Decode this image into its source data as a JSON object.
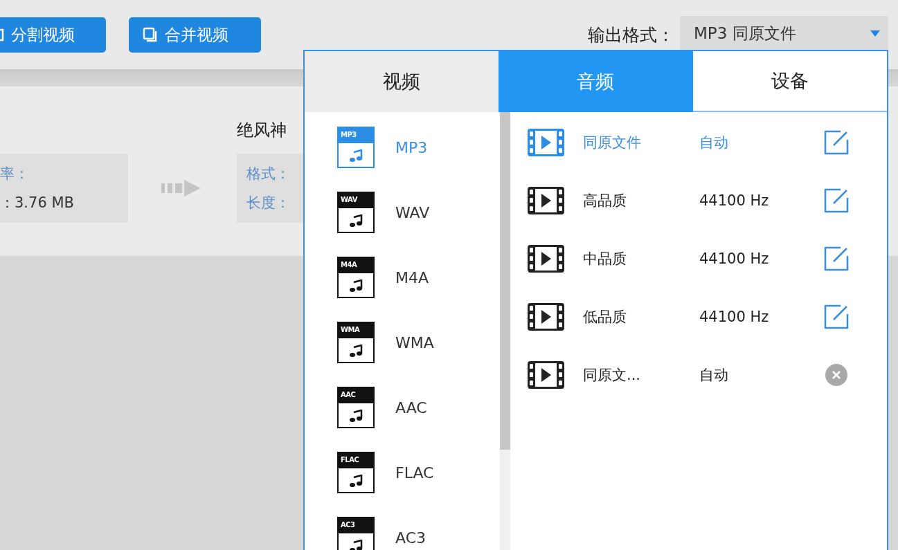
{
  "toolbar": {
    "buttons": [
      {
        "label": "分割视频",
        "kind": "split"
      },
      {
        "label": "合并视频",
        "kind": "merge"
      }
    ],
    "output_format": {
      "label": "输出格式：",
      "value": "MP3  同原文件"
    }
  },
  "file": {
    "title": "绝风神",
    "source": {
      "line_1": "率：",
      "line_2": "：3.76 MB"
    },
    "target": {
      "line_1": "格式：",
      "line_2": "长度："
    }
  },
  "format_popup": {
    "tabs": [
      {
        "label": "视频",
        "selected": false
      },
      {
        "label": "音频",
        "selected": true
      },
      {
        "label": "设备",
        "selected": false
      }
    ],
    "formats": [
      {
        "icon_label": "MP3",
        "name": "MP3",
        "selected": true
      },
      {
        "icon_label": "WAV",
        "name": "WAV",
        "selected": false
      },
      {
        "icon_label": "M4A",
        "name": "M4A",
        "selected": false
      },
      {
        "icon_label": "WMA",
        "name": "WMA",
        "selected": false
      },
      {
        "icon_label": "AAC",
        "name": "AAC",
        "selected": false
      },
      {
        "icon_label": "FLAC",
        "name": "FLAC",
        "selected": false
      },
      {
        "icon_label": "AC3",
        "name": "AC3",
        "selected": false
      }
    ],
    "presets": [
      {
        "name": "同原文件",
        "value": "自动",
        "kind": "edit",
        "selected": true
      },
      {
        "name": "高品质",
        "value": "44100 Hz",
        "kind": "edit",
        "selected": false
      },
      {
        "name": "中品质",
        "value": "44100 Hz",
        "kind": "edit",
        "selected": false
      },
      {
        "name": "低品质",
        "value": "44100 Hz",
        "kind": "edit",
        "selected": false
      },
      {
        "name": "同原文...",
        "value": "自动",
        "kind": "remove",
        "selected": false
      }
    ]
  }
}
